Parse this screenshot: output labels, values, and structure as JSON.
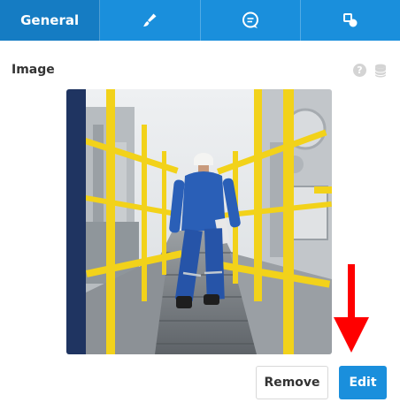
{
  "tabs": [
    {
      "label": "General",
      "icon": "sliders-tab",
      "active": true
    },
    {
      "label": "",
      "icon": "brush-icon"
    },
    {
      "label": "",
      "icon": "chat-icon"
    },
    {
      "label": "",
      "icon": "shapes-icon"
    }
  ],
  "section": {
    "title": "Image",
    "help_icon": "?",
    "help_icon_name": "help-icon",
    "db_icon_name": "database-icon"
  },
  "image": {
    "subject": "worker-on-walkway-photo"
  },
  "buttons": {
    "remove_label": "Remove",
    "edit_label": "Edit"
  },
  "colors": {
    "tab_bg": "#1a8fdc",
    "tab_active_bg": "#157cc3",
    "edit_bg": "#1a8fdc",
    "arrow": "#ff0000"
  }
}
